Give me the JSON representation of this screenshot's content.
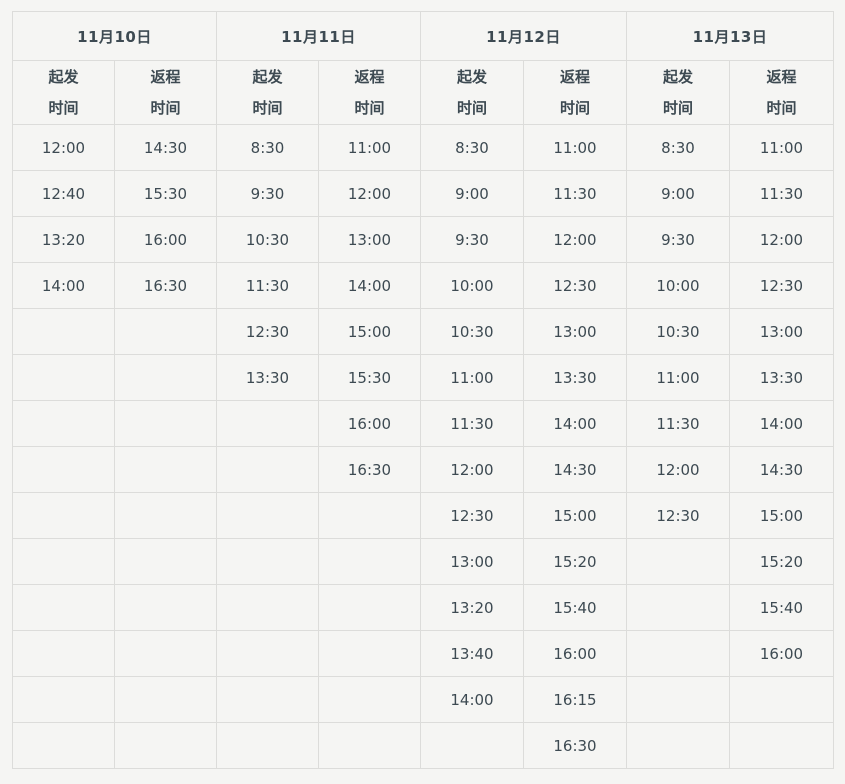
{
  "dates": [
    "11月10日",
    "11月11日",
    "11月12日",
    "11月13日"
  ],
  "sub_headers": {
    "depart": [
      "起发",
      "时间"
    ],
    "return": [
      "返程",
      "时间"
    ]
  },
  "rows": [
    [
      "12:00",
      "14:30",
      "8:30",
      "11:00",
      "8:30",
      "11:00",
      "8:30",
      "11:00"
    ],
    [
      "12:40",
      "15:30",
      "9:30",
      "12:00",
      "9:00",
      "11:30",
      "9:00",
      "11:30"
    ],
    [
      "13:20",
      "16:00",
      "10:30",
      "13:00",
      "9:30",
      "12:00",
      "9:30",
      "12:00"
    ],
    [
      "14:00",
      "16:30",
      "11:30",
      "14:00",
      "10:00",
      "12:30",
      "10:00",
      "12:30"
    ],
    [
      "",
      "",
      "12:30",
      "15:00",
      "10:30",
      "13:00",
      "10:30",
      "13:00"
    ],
    [
      "",
      "",
      "13:30",
      "15:30",
      "11:00",
      "13:30",
      "11:00",
      "13:30"
    ],
    [
      "",
      "",
      "",
      "16:00",
      "11:30",
      "14:00",
      "11:30",
      "14:00"
    ],
    [
      "",
      "",
      "",
      "16:30",
      "12:00",
      "14:30",
      "12:00",
      "14:30"
    ],
    [
      "",
      "",
      "",
      "",
      "12:30",
      "15:00",
      "12:30",
      "15:00"
    ],
    [
      "",
      "",
      "",
      "",
      "13:00",
      "15:20",
      "",
      "15:20"
    ],
    [
      "",
      "",
      "",
      "",
      "13:20",
      "15:40",
      "",
      "15:40"
    ],
    [
      "",
      "",
      "",
      "",
      "13:40",
      "16:00",
      "",
      "16:00"
    ],
    [
      "",
      "",
      "",
      "",
      "14:00",
      "16:15",
      "",
      ""
    ],
    [
      "",
      "",
      "",
      "",
      "",
      "16:30",
      "",
      ""
    ]
  ]
}
